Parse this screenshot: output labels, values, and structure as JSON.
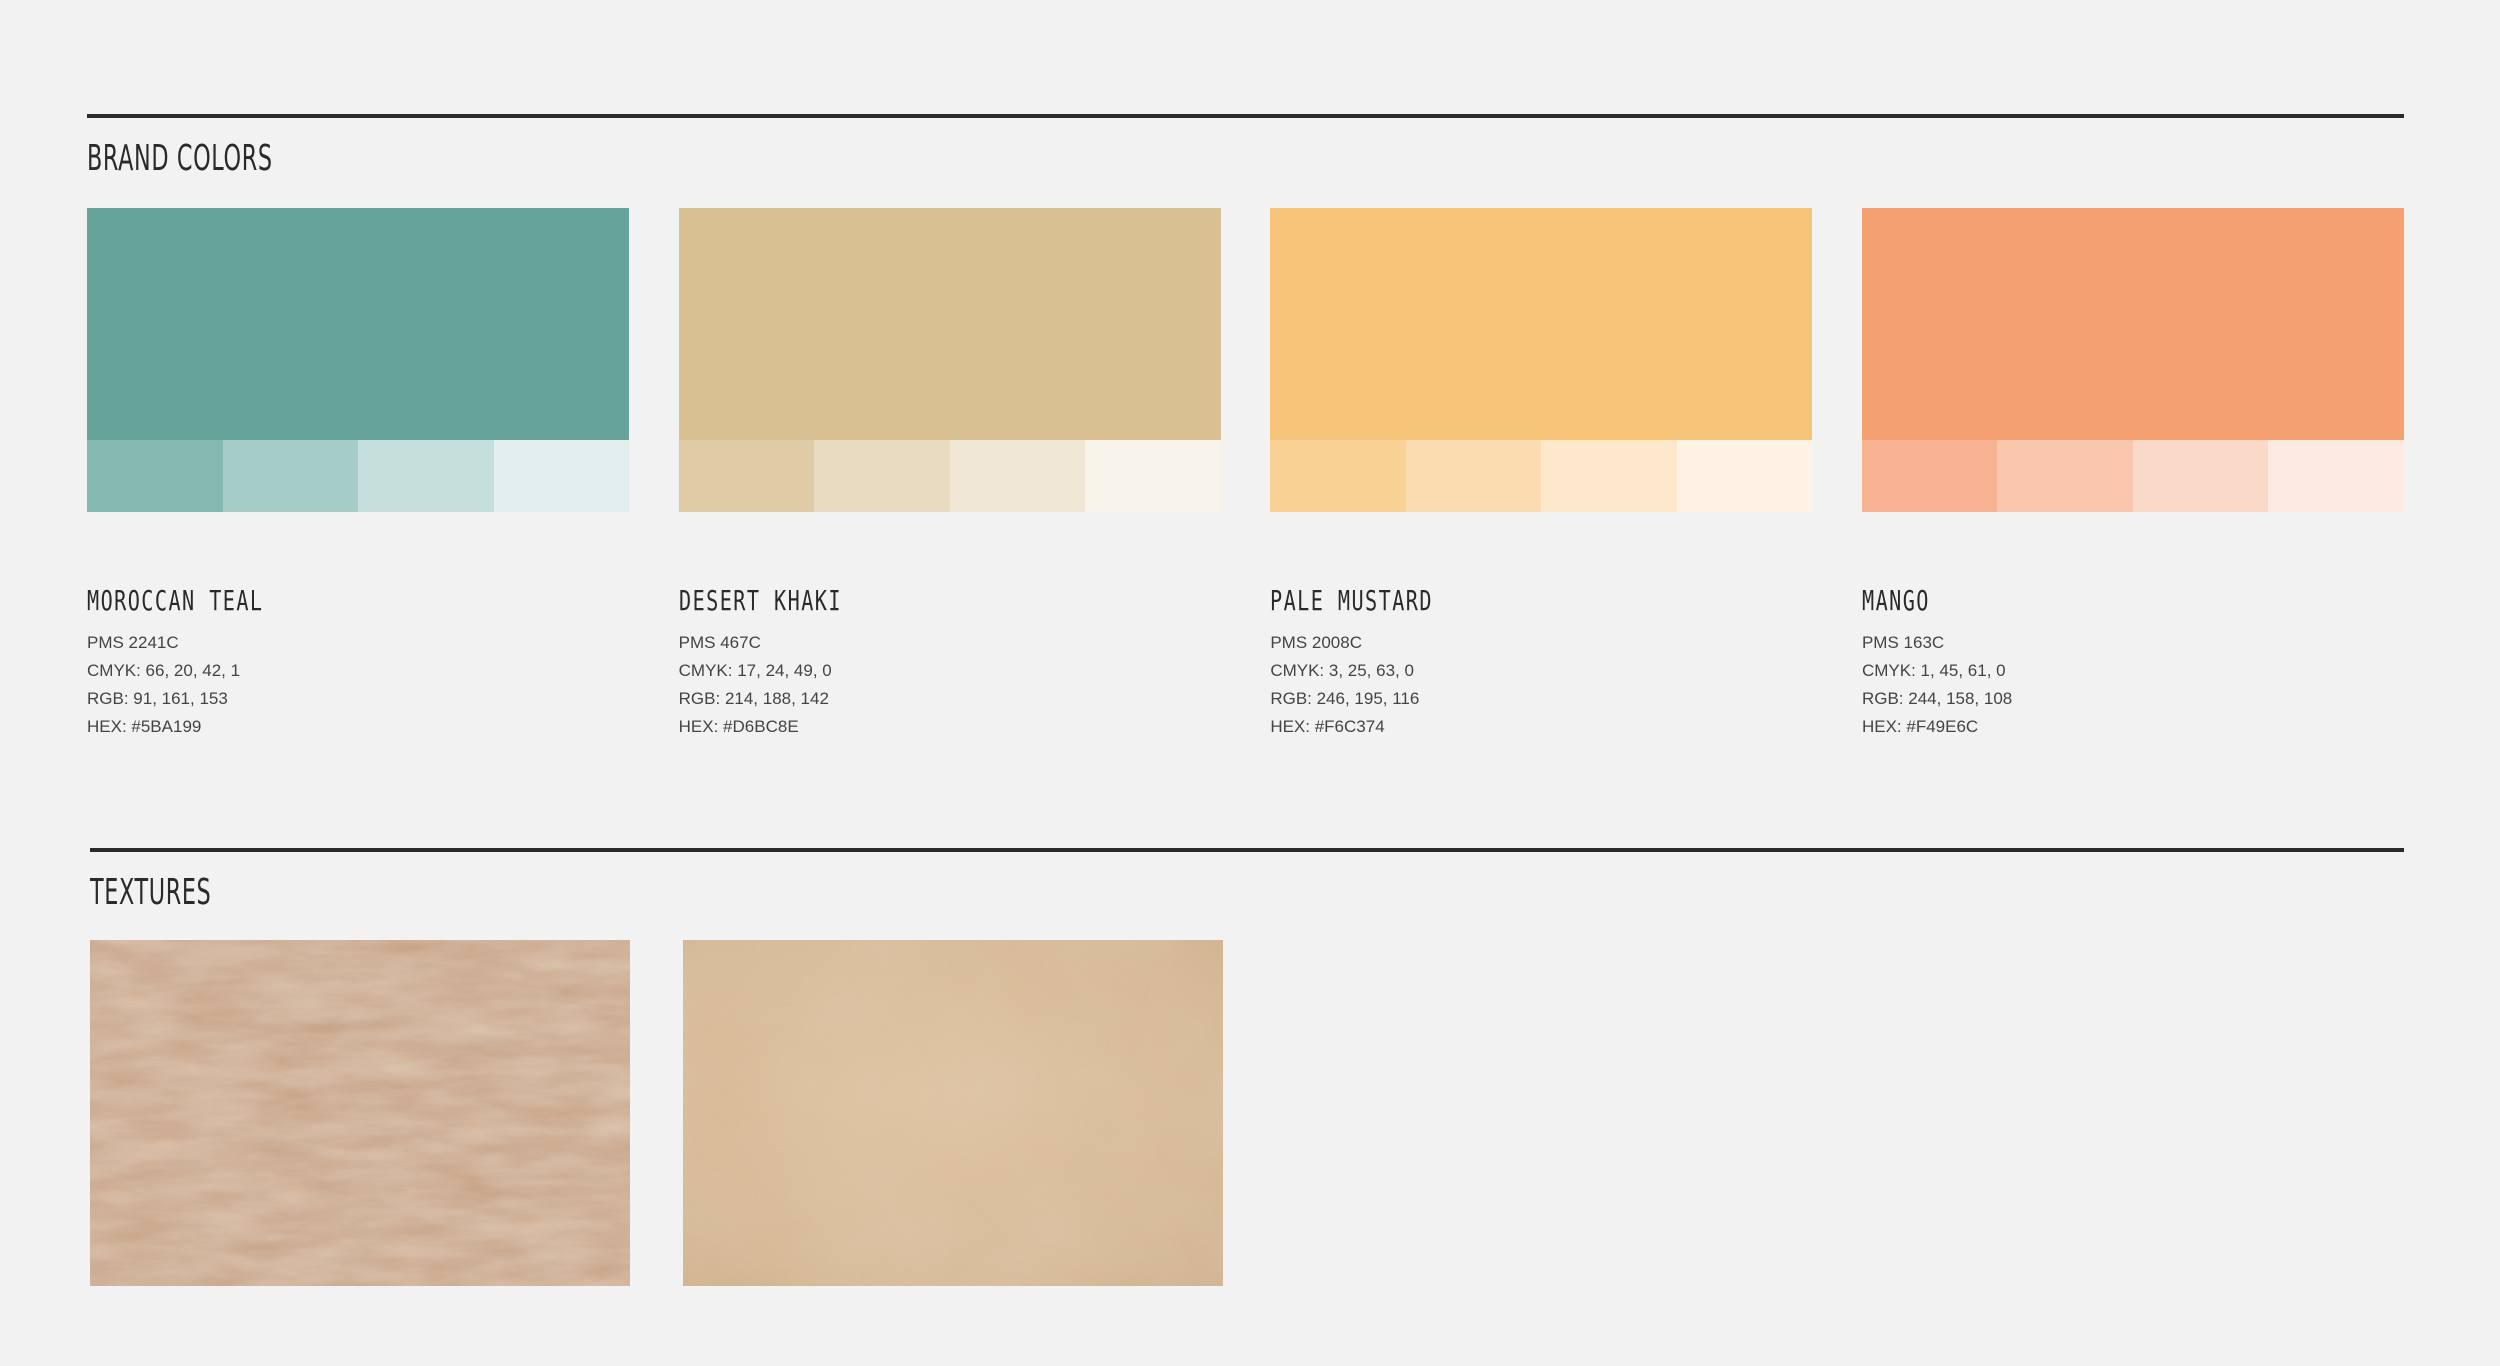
{
  "brand_colors": {
    "heading": "BRAND COLORS",
    "swatches": [
      {
        "name": "MOROCCAN TEAL",
        "pms": "PMS 2241C",
        "cmyk": "CMYK: 66, 20, 42, 1",
        "rgb": "RGB: 91, 161, 153",
        "hex": "HEX: #5BA199",
        "main_color": "#65a39b",
        "tints": [
          "#85b8b1",
          "#a5ccc7",
          "#c5dfdc",
          "#e2efee"
        ]
      },
      {
        "name": "DESERT KHAKI",
        "pms": "PMS 467C",
        "cmyk": "CMYK: 17, 24, 49, 0",
        "rgb": "RGB: 214, 188, 142",
        "hex": "HEX: #D6BC8E",
        "main_color": "#d8c093",
        "tints": [
          "#dfcba6",
          "#e9dbc1",
          "#f0e6d6",
          "#f8f3eb"
        ]
      },
      {
        "name": "PALE MUSTARD",
        "pms": "PMS 2008C",
        "cmyk": "CMYK: 3, 25, 63, 0",
        "rgb": "RGB: 246, 195, 116",
        "hex": "HEX: #F6C374",
        "main_color": "#f7c57a",
        "tints": [
          "#f9d195",
          "#fbdcb0",
          "#fde8cc",
          "#fef3e4"
        ]
      },
      {
        "name": "MANGO",
        "pms": "PMS 163C",
        "cmyk": "CMYK: 1, 45, 61, 0",
        "rgb": "RGB: 244, 158, 108",
        "hex": "HEX: #F49E6C",
        "main_color": "#f5a071",
        "tints": [
          "#f7b391",
          "#f9c7ad",
          "#fbd9c8",
          "#fdebe2"
        ]
      }
    ]
  },
  "textures": {
    "heading": "TEXTURES",
    "items": [
      {
        "icon": "sand-dune-texture"
      },
      {
        "icon": "parchment-texture"
      }
    ]
  }
}
